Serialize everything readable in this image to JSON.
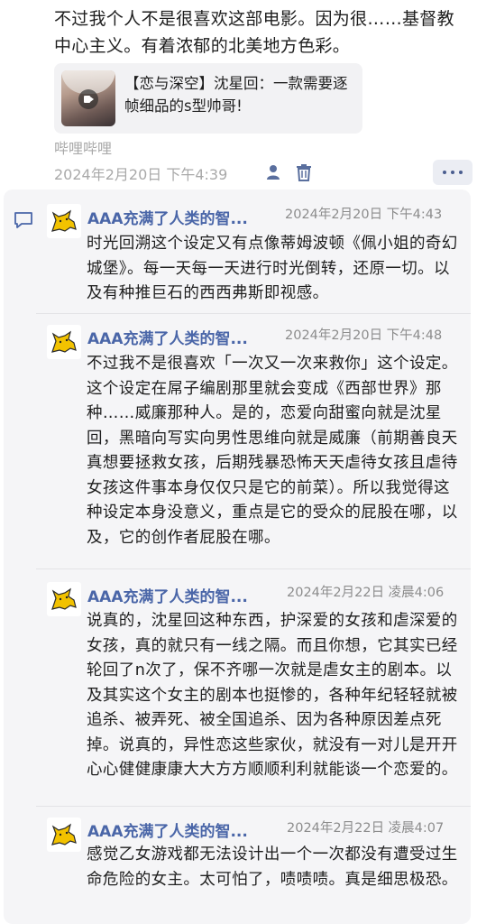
{
  "post": {
    "text": "不过我个人不是很喜欢这部电影。因为很……基督教中心主义。有着浓郁的北美地方色彩。",
    "link_card": {
      "title": "【恋与深空】沈星回：一款需要逐帧细品的s型帅哥!"
    },
    "source": "哔哩哔哩",
    "timestamp": "2024年2月20日 下午4:39"
  },
  "icons": {
    "user": "person-icon",
    "trash": "trash-icon",
    "more": "more-dots-icon",
    "comment": "comment-icon",
    "play": "video-play-icon",
    "avatar": "cat-avatar-icon"
  },
  "colors": {
    "link_blue": "#4a66a8",
    "meta_gray": "#a9a9a9",
    "avatar_yellow": "#f2c200"
  },
  "comments": [
    {
      "author": "AAA充满了人类的智...",
      "time": "2024年2月20日 下午4:43",
      "text": "时光回溯这个设定又有点像蒂姆波顿《佩小姐的奇幻城堡》。每一天每一天进行时光倒转，还原一切。以及有种推巨石的西西弗斯即视感。"
    },
    {
      "author": "AAA充满了人类的智...",
      "time": "2024年2月20日 下午4:48",
      "text": "不过我不是很喜欢「一次又一次来救你」这个设定。这个设定在屌子编剧那里就会变成《西部世界》那种……威廉那种人。是的，恋爱向甜蜜向就是沈星回，黑暗向写实向男性思维向就是威廉（前期善良天真想要拯救女孩，后期残暴恐怖天天虐待女孩且虐待女孩这件事本身仅仅只是它的前菜）。所以我觉得这种设定本身没意义，重点是它的受众的屁股在哪，以及，它的创作者屁股在哪。"
    },
    {
      "author": "AAA充满了人类的智...",
      "time": "2024年2月22日 凌晨4:06",
      "text": "说真的，沈星回这种东西，护深爱的女孩和虐深爱的女孩，真的就只有一线之隔。而且你想，它其实已经轮回了n次了，保不齐哪一次就是虐女主的剧本。以及其实这个女主的剧本也挺惨的，各种年纪轻轻就被追杀、被弄死、被全国追杀、因为各种原因差点死掉。说真的，异性恋这些家伙，就没有一对儿是开开心心健健康康大大方方顺顺利利就能谈一个恋爱的。"
    },
    {
      "author": "AAA充满了人类的智...",
      "time": "2024年2月22日 凌晨4:07",
      "text": "感觉乙女游戏都无法设计出一个一次都没有遭受过生命危险的女主。太可怕了，啧啧啧。真是细思极恐。"
    }
  ]
}
